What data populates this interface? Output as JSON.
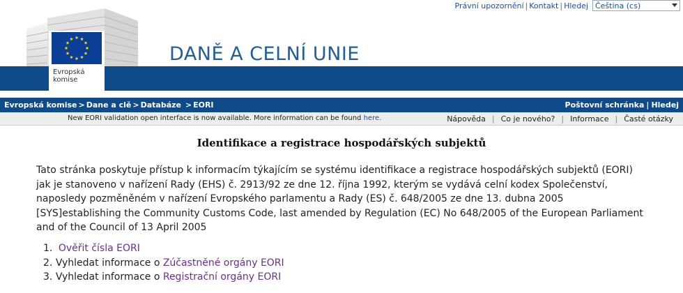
{
  "top_links": {
    "legal": "Právní upozornění",
    "contact": "Kontakt",
    "search": "Hledej",
    "language": "Čeština (cs)"
  },
  "logo": {
    "line1": "Evropská",
    "line2": "komise"
  },
  "site_title": "DANĚ A CELNÍ UNIE",
  "breadcrumb": {
    "items": [
      "Evropská komise",
      "Dane a clě",
      "Databáze",
      "EORI"
    ],
    "separator": ">",
    "right_mailbox": "Poštovní schránka",
    "right_search": "Hledej"
  },
  "notice": {
    "text": "New EORI validation open interface is now available. More information can be found ",
    "link": "here.",
    "help_menu": [
      "Nápověda",
      "Co je nového?",
      "Informace",
      "Časté otázky"
    ]
  },
  "main": {
    "title": "Identifikace a registrace hospodářských subjektů",
    "intro": "Tato stránka poskytuje přístup k informacím týkajícím se systému identifikace a registrace hospodářských subjektů (EORI) jak je stanoveno v nařízení Rady (EHS) č. 2913/92 ze dne 12. října 1992, kterým se vydává celní kodex Společenství, naposledy pozměněném v nařízení Evropského parlamentu a Rady (ES) č. 648/2005 ze dne 13. dubna 2005 [SYS]establishing the Community Customs Code, last amended by Regulation (EC) No 648/2005 of the European Parliament and of the Council of 13 April 2005",
    "list": [
      {
        "num": "1.",
        "prefix": "",
        "link": "Ověřit čísla EORI"
      },
      {
        "num": "2.",
        "prefix": "Vyhledat informace o ",
        "link": "Zúčastněné orgány EORI"
      },
      {
        "num": "3.",
        "prefix": "Vyhledat informace o ",
        "link": "Registrační orgány EORI"
      }
    ]
  },
  "colors": {
    "brand_blue": "#0f4a8a",
    "title_blue": "#1f5e96",
    "link_purple": "#6a2f8f"
  }
}
